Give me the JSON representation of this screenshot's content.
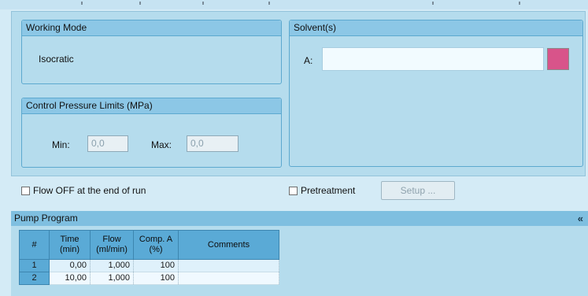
{
  "working_mode": {
    "title": "Working Mode",
    "value": "Isocratic"
  },
  "solvents": {
    "title": "Solvent(s)",
    "label": "A:",
    "value": "",
    "color": "#d8548a"
  },
  "pressure_limits": {
    "title": "Control Pressure Limits (MPa)",
    "min_label": "Min:",
    "min_value": "0,0",
    "max_label": "Max:",
    "max_value": "0,0"
  },
  "options": {
    "flow_off_label": "Flow OFF at the end of run",
    "flow_off_checked": false,
    "pretreatment_label": "Pretreatment",
    "pretreatment_checked": false,
    "setup_label": "Setup ..."
  },
  "pump_program": {
    "title": "Pump Program",
    "collapse_glyph": "«",
    "columns": [
      "#",
      "Time\n(min)",
      "Flow\n(ml/min)",
      "Comp. A\n(%)",
      "Comments"
    ],
    "rows": [
      {
        "num": "1",
        "time": "0,00",
        "flow": "1,000",
        "comp_a": "100",
        "comment": ""
      },
      {
        "num": "2",
        "time": "10,00",
        "flow": "1,000",
        "comp_a": "100",
        "comment": ""
      }
    ]
  }
}
